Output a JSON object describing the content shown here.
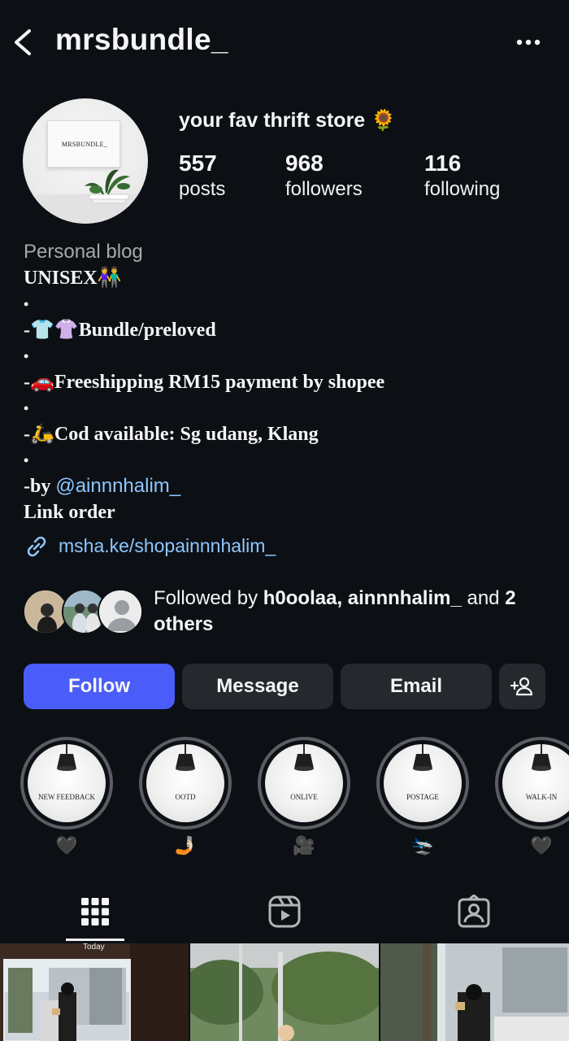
{
  "header": {
    "username": "mrsbundle_",
    "back_icon": "chevron-left-icon",
    "more_icon": "more-horizontal-icon"
  },
  "profile": {
    "avatar_text": "MRSBUNDLE_",
    "name": "your fav thrift store 🌻",
    "stats": [
      {
        "value": "557",
        "label": "posts"
      },
      {
        "value": "968",
        "label": "followers"
      },
      {
        "value": "116",
        "label": "following"
      }
    ]
  },
  "bio": {
    "category": "Personal blog",
    "lines": [
      "UNISEX👫",
      "•",
      "-👕👚Bundle/preloved",
      "•",
      "-🚗Freeshipping RM15 payment by shopee",
      "•",
      "-🛵Cod available: Sg udang, Klang",
      "•"
    ],
    "by_prefix": "-by ",
    "by_mention": "@ainnnhalim_",
    "link_label": "Link order",
    "link_url": "msha.ke/shopainnnhalim_"
  },
  "followed_by": {
    "prefix": "Followed by ",
    "user1": "h0oolaa",
    "sep": ", ",
    "user2": "ainnnhalim_",
    "mid": " and ",
    "count": "2 others"
  },
  "actions": {
    "follow": "Follow",
    "message": "Message",
    "email": "Email",
    "add_user_icon": "add-user-icon"
  },
  "highlights": [
    {
      "label": "NEW FEEDBACK",
      "emoji": "🖤"
    },
    {
      "label": "OOTD",
      "emoji": "🤳🏻"
    },
    {
      "label": "ONLIVE",
      "emoji": "🎥"
    },
    {
      "label": "POSTAGE",
      "emoji": "🛬"
    },
    {
      "label": "WALK-IN",
      "emoji": "🖤"
    }
  ],
  "tabs": [
    {
      "name": "grid-icon",
      "active": true
    },
    {
      "name": "reels-icon",
      "active": false
    },
    {
      "name": "tagged-icon",
      "active": false
    }
  ],
  "grid": {
    "today_label": "Today"
  },
  "colors": {
    "background": "#0c1014",
    "follow_button": "#4a5df9",
    "secondary_button": "#25292e",
    "link": "#8ec6ff"
  }
}
